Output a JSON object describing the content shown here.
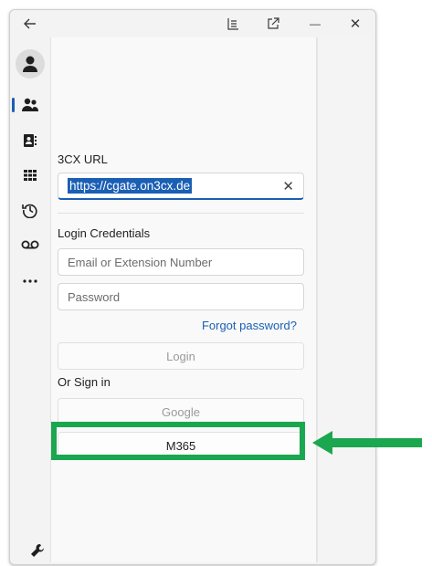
{
  "titlebar": {
    "back_icon": "arrow-left-icon",
    "icons": [
      "layout-icon",
      "open-external-icon",
      "minimize-icon",
      "close-icon"
    ],
    "close_glyph": "✕",
    "minimize_glyph": "—"
  },
  "sidebar": {
    "items": [
      {
        "name": "contacts",
        "icon": "people-icon"
      },
      {
        "name": "address-book",
        "icon": "address-book-icon"
      },
      {
        "name": "dialpad",
        "icon": "dialpad-icon"
      },
      {
        "name": "history",
        "icon": "history-icon"
      },
      {
        "name": "voicemail",
        "icon": "voicemail-icon"
      },
      {
        "name": "more",
        "icon": "more-icon"
      }
    ],
    "settings_icon": "wrench-icon"
  },
  "form": {
    "url_label": "3CX URL",
    "url_value": "https://cgate.on3cx.de",
    "clear_glyph": "✕",
    "credentials_label": "Login Credentials",
    "email_placeholder": "Email or Extension Number",
    "password_placeholder": "Password",
    "forgot_link": "Forgot password?",
    "login_button": "Login",
    "or_sign_in": "Or Sign in",
    "google_button": "Google",
    "m365_button": "M365"
  },
  "annotation": {
    "highlight_color": "#1aa74f",
    "arrow_color": "#1aa74f"
  }
}
